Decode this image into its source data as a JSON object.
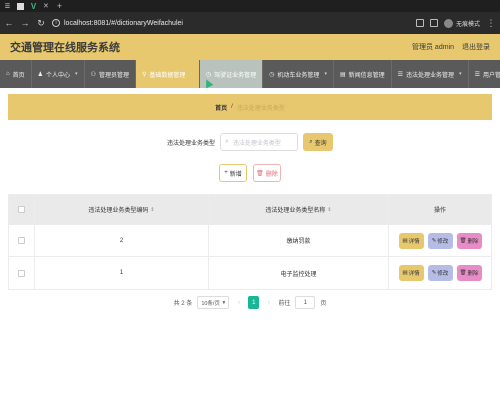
{
  "browser": {
    "url": "localhost:8081/#/dictionaryWeifachulei",
    "profile_label": "无痕模式"
  },
  "header": {
    "title": "交通管理在线服务系统",
    "user_label": "管理员 admin",
    "logout_label": "退出登录"
  },
  "menu": [
    {
      "label": "首页"
    },
    {
      "label": "个人中心"
    },
    {
      "label": "管理员管理"
    },
    {
      "label": "基础数据管理"
    },
    {
      "label": "驾驶证业务管理"
    },
    {
      "label": "机动车业务管理"
    },
    {
      "label": "新闻信息管理"
    },
    {
      "label": "违法处理业务管理"
    },
    {
      "label": "用户管理"
    }
  ],
  "breadcrumb": {
    "home": "首页",
    "separator": "/",
    "current": "违法处理业务类型"
  },
  "search": {
    "label": "违法处理业务类型",
    "placeholder": "违法处理业务类型",
    "query_label": "查询"
  },
  "actions": {
    "add_label": "新增",
    "delete_label": "删除"
  },
  "table": {
    "headers": {
      "code": "违法处理业务类型编码",
      "name": "违法处理业务类型名称",
      "ops": "操作"
    },
    "rows": [
      {
        "code": "2",
        "name": "缴纳罚款"
      },
      {
        "code": "1",
        "name": "电子监控处理"
      }
    ],
    "row_actions": {
      "detail": "详情",
      "edit": "修改",
      "delete": "删除"
    }
  },
  "pagination": {
    "total": "共 2 条",
    "page_size": "10条/页",
    "current_page": "1",
    "goto_prefix": "前往",
    "goto_value": "1",
    "goto_suffix": "页"
  },
  "colors": {
    "accent": "#e7c86e",
    "menu_bg": "#5a5a5a",
    "pager_active": "#18b696",
    "edit": "#b5bde6",
    "delete": "#e88cc8"
  }
}
